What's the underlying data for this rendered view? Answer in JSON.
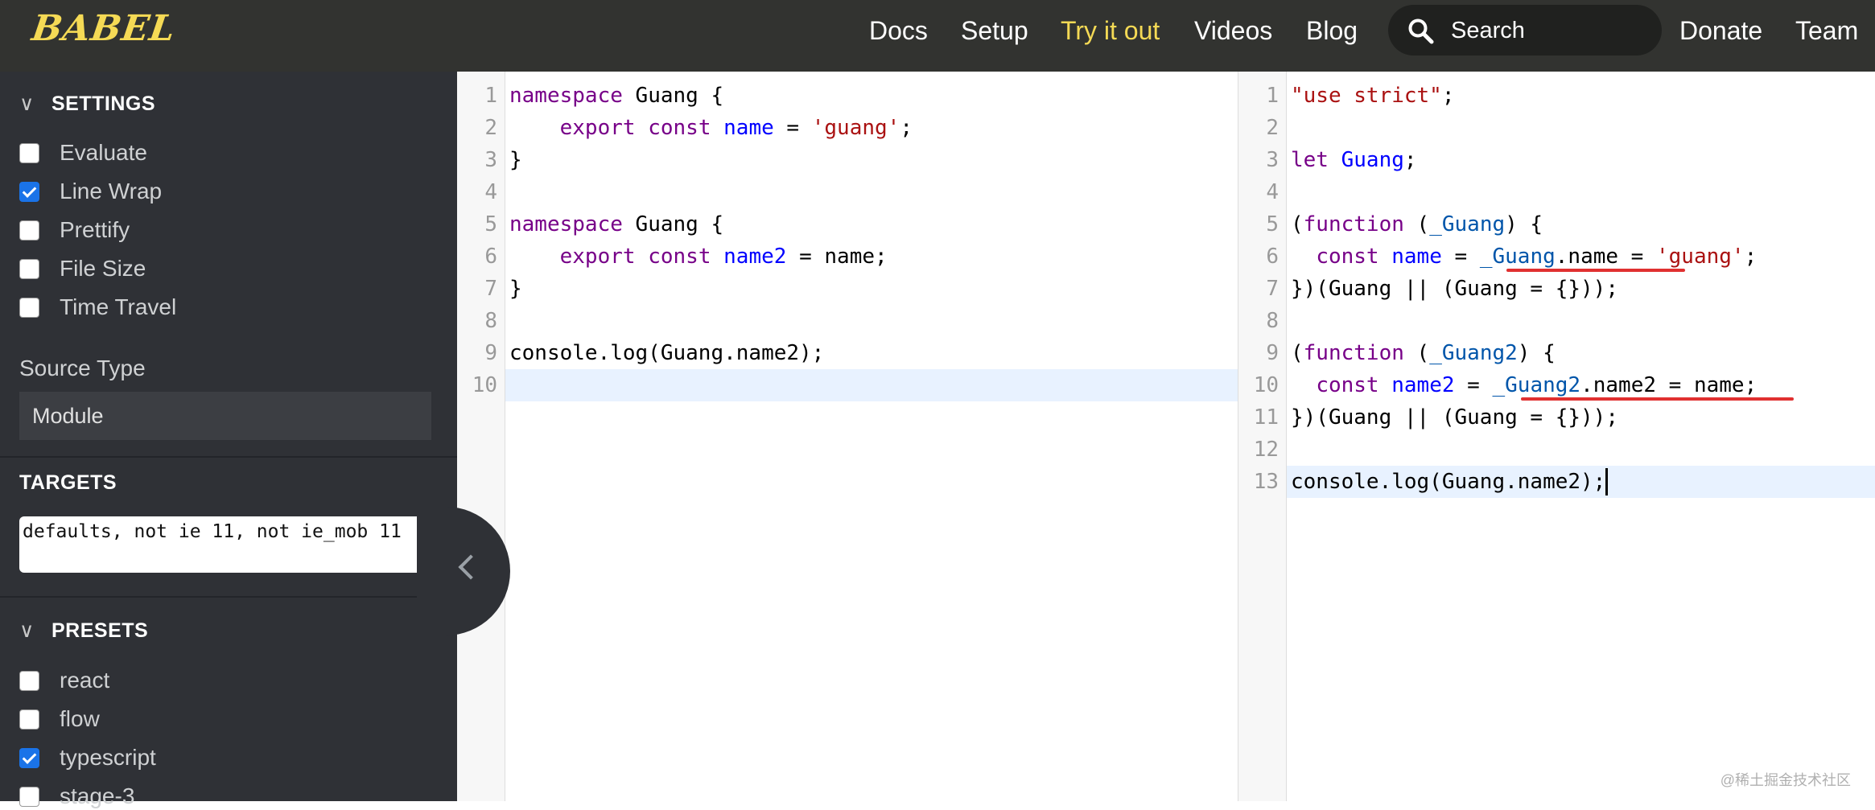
{
  "nav": {
    "logo": "BABEL",
    "items": [
      "Docs",
      "Setup",
      "Try it out",
      "Videos",
      "Blog"
    ],
    "search_placeholder": "Search",
    "donate": "Donate",
    "team": "Team"
  },
  "sidebar": {
    "settings_title": "SETTINGS",
    "settings": [
      {
        "label": "Evaluate",
        "checked": false
      },
      {
        "label": "Line Wrap",
        "checked": true
      },
      {
        "label": "Prettify",
        "checked": false
      },
      {
        "label": "File Size",
        "checked": false
      },
      {
        "label": "Time Travel",
        "checked": false
      }
    ],
    "source_type_label": "Source Type",
    "source_type_value": "Module",
    "targets_title": "TARGETS",
    "targets_value": "defaults, not ie 11, not ie_mob 11",
    "presets_title": "PRESETS",
    "presets": [
      {
        "label": "react",
        "checked": false
      },
      {
        "label": "flow",
        "checked": false
      },
      {
        "label": "typescript",
        "checked": true
      },
      {
        "label": "stage-3",
        "checked": false
      }
    ]
  },
  "input_editor": {
    "lines": [
      "namespace Guang {",
      "    export const name = 'guang';",
      "}",
      "",
      "namespace Guang {",
      "    export const name2 = name;",
      "}",
      "",
      "console.log(Guang.name2);",
      ""
    ]
  },
  "output_editor": {
    "lines": [
      "\"use strict\";",
      "",
      "let Guang;",
      "",
      "(function (_Guang) {",
      "  const name = _Guang.name = 'guang';",
      "})(Guang || (Guang = {}));",
      "",
      "(function (_Guang2) {",
      "  const name2 = _Guang2.name2 = name;",
      "})(Guang || (Guang = {}));",
      "",
      "console.log(Guang.name2);"
    ]
  },
  "colors": {
    "accent": "#f5da55",
    "keyword": "#770088",
    "definition": "#0000ff",
    "string": "#aa1111",
    "annotation": "#e03030"
  },
  "watermark": "@稀土掘金技术社区"
}
